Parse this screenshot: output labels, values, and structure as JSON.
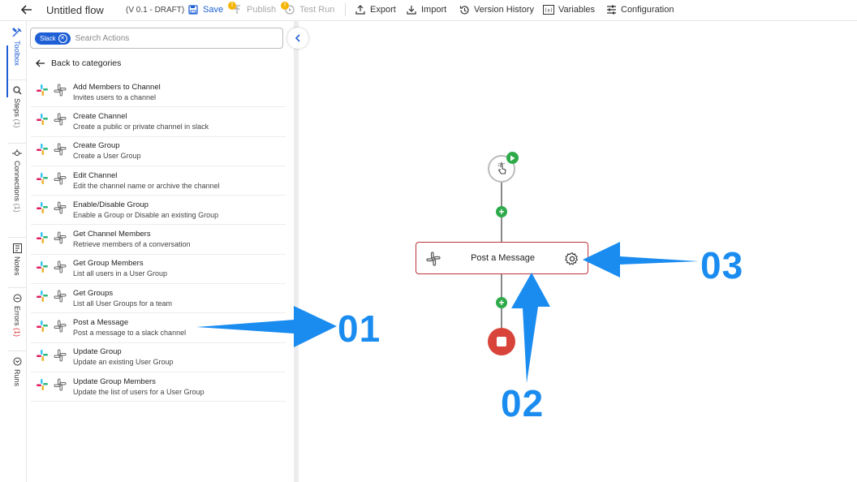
{
  "toolbar": {
    "flow_title": "Untitled flow",
    "version": "(V 0.1 - DRAFT)",
    "save": "Save",
    "publish": "Publish",
    "test_run": "Test Run",
    "export": "Export",
    "import": "Import",
    "version_history": "Version History",
    "variables": "Variables",
    "configuration": "Configuration",
    "publish_badge": "!",
    "testrun_badge": "!"
  },
  "rail": {
    "toolbox": "Toolbox",
    "steps": "Steps",
    "steps_count": "(1)",
    "connections": "Connections",
    "connections_count": "(1)",
    "notes": "Notes",
    "errors": "Errors",
    "errors_count": "(1)",
    "runs": "Runs"
  },
  "toolbox": {
    "filter_chip": "Slack",
    "search_placeholder": "Search Actions",
    "back_label": "Back to categories",
    "actions": [
      {
        "title": "Add Members to Channel",
        "desc": "Invites users to a channel"
      },
      {
        "title": "Create Channel",
        "desc": "Create a public or private channel in slack"
      },
      {
        "title": "Create Group",
        "desc": "Create a User Group"
      },
      {
        "title": "Edit Channel",
        "desc": "Edit the channel name or archive the channel"
      },
      {
        "title": "Enable/Disable Group",
        "desc": "Enable a Group or Disable an existing Group"
      },
      {
        "title": "Get Channel Members",
        "desc": "Retrieve members of a conversation"
      },
      {
        "title": "Get Group Members",
        "desc": "List all users in a User Group"
      },
      {
        "title": "Get Groups",
        "desc": "List all User Groups for a team"
      },
      {
        "title": "Post a Message",
        "desc": "Post a message to a slack channel"
      },
      {
        "title": "Update Group",
        "desc": "Update an existing User Group"
      },
      {
        "title": "Update Group Members",
        "desc": "Update the list of users for a User Group"
      }
    ]
  },
  "canvas": {
    "node_label": "Post a Message",
    "plus": "+"
  },
  "annotations": {
    "c1": "01",
    "c2": "02",
    "c3": "03"
  },
  "colors": {
    "accent": "#1e5fd6",
    "node_border": "#c0333b",
    "add_green": "#2eaa4a",
    "stop_red": "#d9443a",
    "callout_blue": "#1a8cf0"
  }
}
